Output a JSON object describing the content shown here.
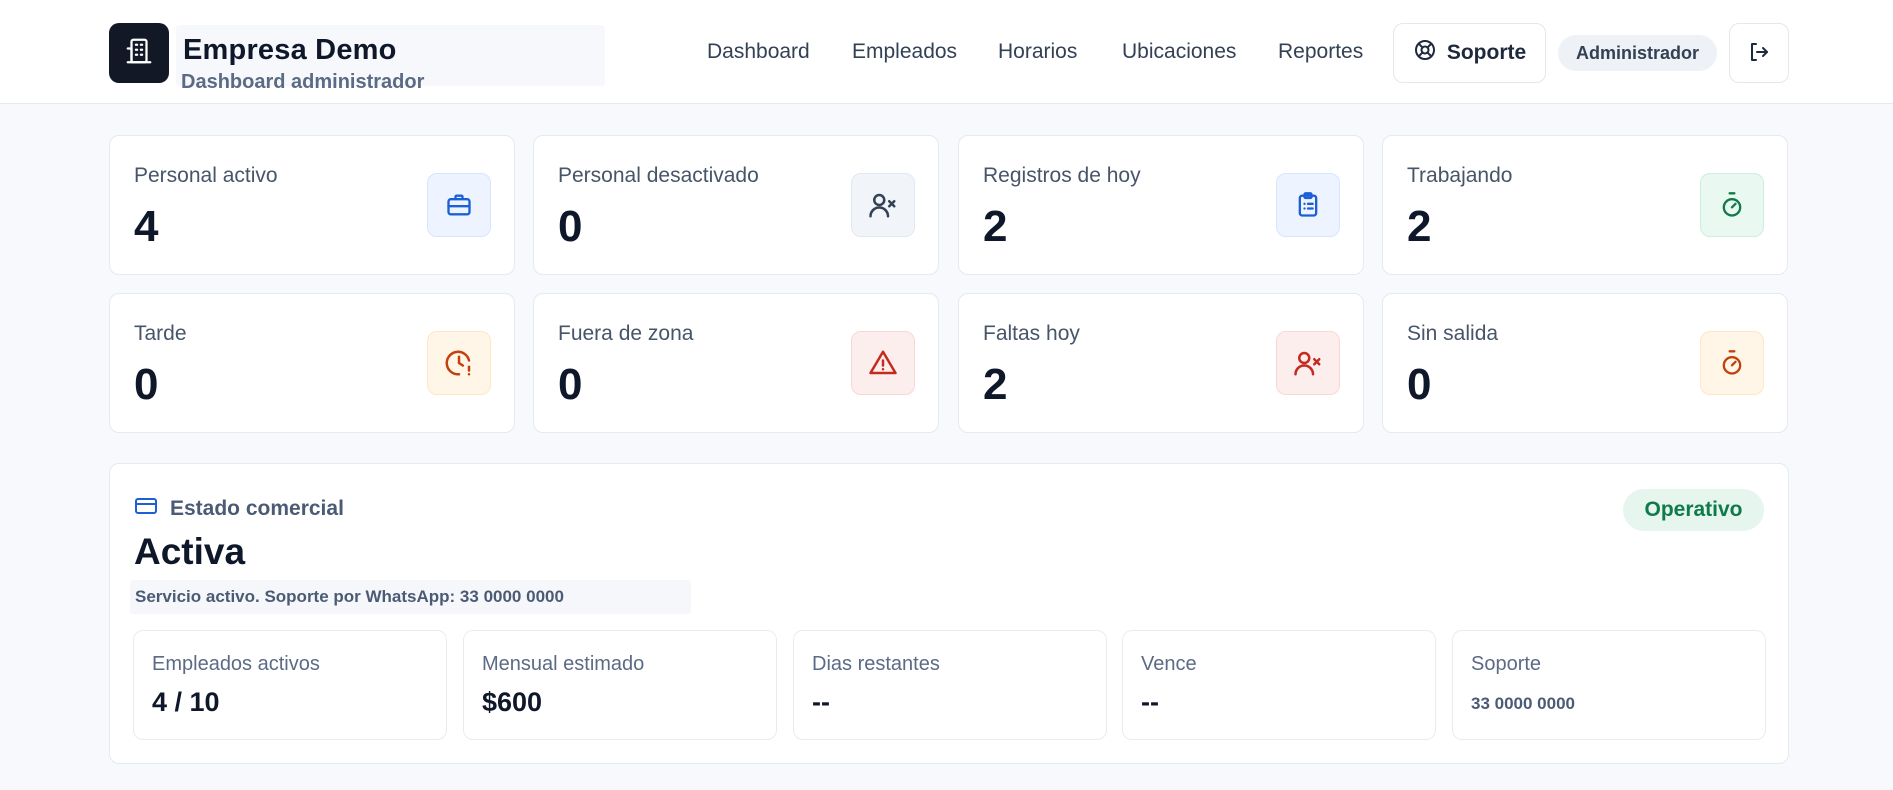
{
  "header": {
    "brand_icon": "building-icon",
    "title": "Empresa Demo",
    "subtitle": "Dashboard administrador",
    "nav": [
      {
        "label": "Dashboard"
      },
      {
        "label": "Empleados"
      },
      {
        "label": "Horarios"
      },
      {
        "label": "Ubicaciones"
      },
      {
        "label": "Reportes"
      }
    ],
    "support_label": "Soporte",
    "support_icon": "lifebuoy-icon",
    "role": "Administrador",
    "logout_icon": "logout-icon"
  },
  "stats": [
    {
      "label": "Personal activo",
      "value": "4",
      "icon": "briefcase-icon",
      "color": "#1d5fd6",
      "bg": "#eef4ff"
    },
    {
      "label": "Personal desactivado",
      "value": "0",
      "icon": "user-x-icon",
      "color": "#334155",
      "bg": "#f1f4f8"
    },
    {
      "label": "Registros de hoy",
      "value": "2",
      "icon": "clipboard-list-icon",
      "color": "#1d5fd6",
      "bg": "#eef4ff"
    },
    {
      "label": "Trabajando",
      "value": "2",
      "icon": "stopwatch-icon",
      "color": "#0f7a4a",
      "bg": "#e9f8f0"
    },
    {
      "label": "Tarde",
      "value": "0",
      "icon": "clock-alert-icon",
      "color": "#c2410c",
      "bg": "#fff6e8"
    },
    {
      "label": "Fuera de zona",
      "value": "0",
      "icon": "warning-icon",
      "color": "#c52a1f",
      "bg": "#fdeeee"
    },
    {
      "label": "Faltas hoy",
      "value": "2",
      "icon": "user-x-icon",
      "color": "#c52a1f",
      "bg": "#fdeeee"
    },
    {
      "label": "Sin salida",
      "value": "0",
      "icon": "stopwatch-icon",
      "color": "#c2410c",
      "bg": "#fff6e8"
    }
  ],
  "commercial": {
    "kicker": "Estado comercial",
    "kicker_icon": "credit-card-icon",
    "title": "Activa",
    "status": "Operativo",
    "note": "Servicio activo. Soporte por WhatsApp: 33 0000 0000",
    "details": [
      {
        "label": "Empleados activos",
        "value": "4 / 10"
      },
      {
        "label": "Mensual estimado",
        "value": "$600"
      },
      {
        "label": "Dias restantes",
        "value": "--"
      },
      {
        "label": "Vence",
        "value": "--"
      },
      {
        "label": "Soporte",
        "value": "33 0000 0000"
      }
    ]
  }
}
